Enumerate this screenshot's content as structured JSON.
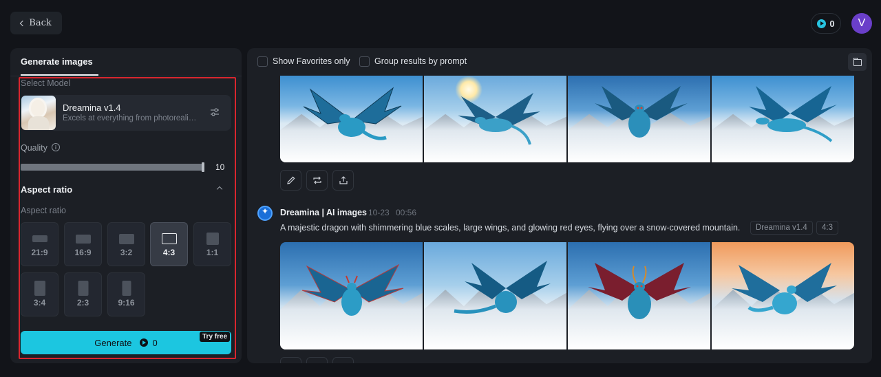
{
  "header": {
    "back_label": "Back",
    "credits": "0",
    "avatar_initial": "V"
  },
  "left": {
    "tab_label": "Generate images",
    "select_model_label": "Select Model",
    "model": {
      "name": "Dreamina v1.4",
      "description": "Excels at everything from photorealism..."
    },
    "quality_label": "Quality",
    "quality_value": "10",
    "quality_level": 1.0,
    "aspect_heading": "Aspect ratio",
    "aspect_sublabel": "Aspect ratio",
    "ratios": [
      "21:9",
      "16:9",
      "3:2",
      "4:3",
      "1:1",
      "3:4",
      "2:3",
      "9:16"
    ],
    "selected_ratio": "4:3",
    "generate_label": "Generate",
    "generate_cost": "0",
    "try_free_label": "Try free"
  },
  "right": {
    "show_favorites_label": "Show Favorites only",
    "group_results_label": "Group results by prompt",
    "post": {
      "author": "Dreamina | AI images",
      "date": "10-23",
      "time": "00:56",
      "prompt": "A majestic dragon with shimmering blue scales, large wings, and glowing red eyes, flying over a snow-covered mountain.",
      "model_tag": "Dreamina v1.4",
      "ratio_tag": "4:3"
    }
  },
  "colors": {
    "accent": "#1cc6e0",
    "highlight_border": "#d9262e",
    "avatar": "#6a3fc9"
  }
}
